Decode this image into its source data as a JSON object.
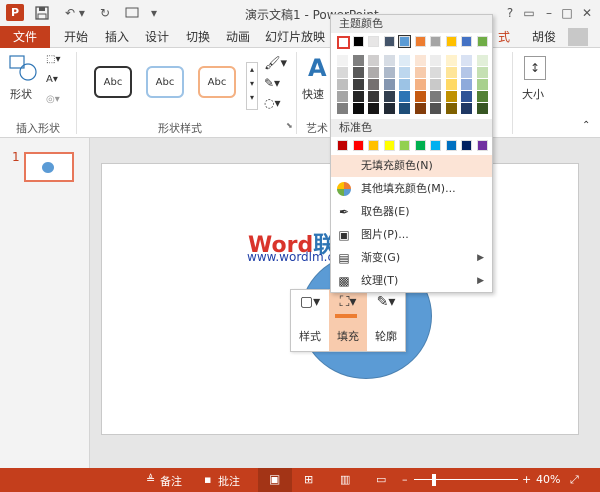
{
  "window": {
    "app_icon": "P",
    "title": "演示文稿1 - PowerPoint"
  },
  "tabs": {
    "file": "文件",
    "items": [
      "开始",
      "插入",
      "设计",
      "切换",
      "动画",
      "幻灯片放映"
    ],
    "right_tab": "式",
    "user": "胡俊"
  },
  "ribbon": {
    "group_insert_shape": "插入形状",
    "shape_label": "形状",
    "group_shape_style": "形状样式",
    "style_sample": "Abc",
    "group_art": "艺术",
    "quick_style": "快速",
    "size_label": "大小"
  },
  "slides": {
    "number": "1"
  },
  "fill_menu": {
    "theme_colors_header": "主题颜色",
    "standard_colors_header": "标准色",
    "no_fill": "无填充颜色(N)",
    "more_colors": "其他填充颜色(M)...",
    "eyedropper": "取色器(E)",
    "picture": "图片(P)...",
    "gradient": "渐变(G)",
    "texture": "纹理(T)",
    "theme_top_row": [
      "#ffffff",
      "#000000",
      "#e7e6e6",
      "#44546a",
      "#5b9bd5",
      "#ed7d31",
      "#a5a5a5",
      "#ffc000",
      "#4472c4",
      "#70ad47"
    ],
    "theme_shades": [
      [
        "#f2f2f2",
        "#7f7f7f",
        "#d0cece",
        "#d6dce4",
        "#deebf6",
        "#fbe5d5",
        "#ededed",
        "#fff2cc",
        "#d9e2f3",
        "#e2efd9"
      ],
      [
        "#d8d8d8",
        "#595959",
        "#aeabab",
        "#adb9ca",
        "#bdd7ee",
        "#f7cbac",
        "#dbdbdb",
        "#fee599",
        "#b4c6e7",
        "#c5e0b3"
      ],
      [
        "#bfbfbf",
        "#3f3f3f",
        "#757070",
        "#8496b0",
        "#9cc3e5",
        "#f4b183",
        "#c9c9c9",
        "#ffd965",
        "#8eaadb",
        "#a8d08d"
      ],
      [
        "#a5a5a5",
        "#262626",
        "#3a3838",
        "#323f4f",
        "#2e75b5",
        "#c55a11",
        "#7b7b7b",
        "#bf9000",
        "#2f5496",
        "#538135"
      ],
      [
        "#7f7f7f",
        "#0c0c0c",
        "#171616",
        "#222a35",
        "#1e4e79",
        "#833c0b",
        "#525252",
        "#7f6000",
        "#1f3864",
        "#375623"
      ]
    ],
    "standard_row": [
      "#c00000",
      "#ff0000",
      "#ffc000",
      "#ffff00",
      "#92d050",
      "#00b050",
      "#00b0f0",
      "#0070c0",
      "#002060",
      "#7030a0"
    ]
  },
  "mini_toolbar": {
    "style": "样式",
    "fill": "填充",
    "outline": "轮廓"
  },
  "watermark": {
    "brand_word": "Word",
    "brand_cn": "联盟",
    "url": "www.wordlm.com"
  },
  "status": {
    "notes": "备注",
    "comments": "批注",
    "zoom": "40%"
  },
  "colors": {
    "accent": "#c43e1c",
    "shape_fill": "#5b9bd5",
    "highlight": "#fce4d6"
  }
}
